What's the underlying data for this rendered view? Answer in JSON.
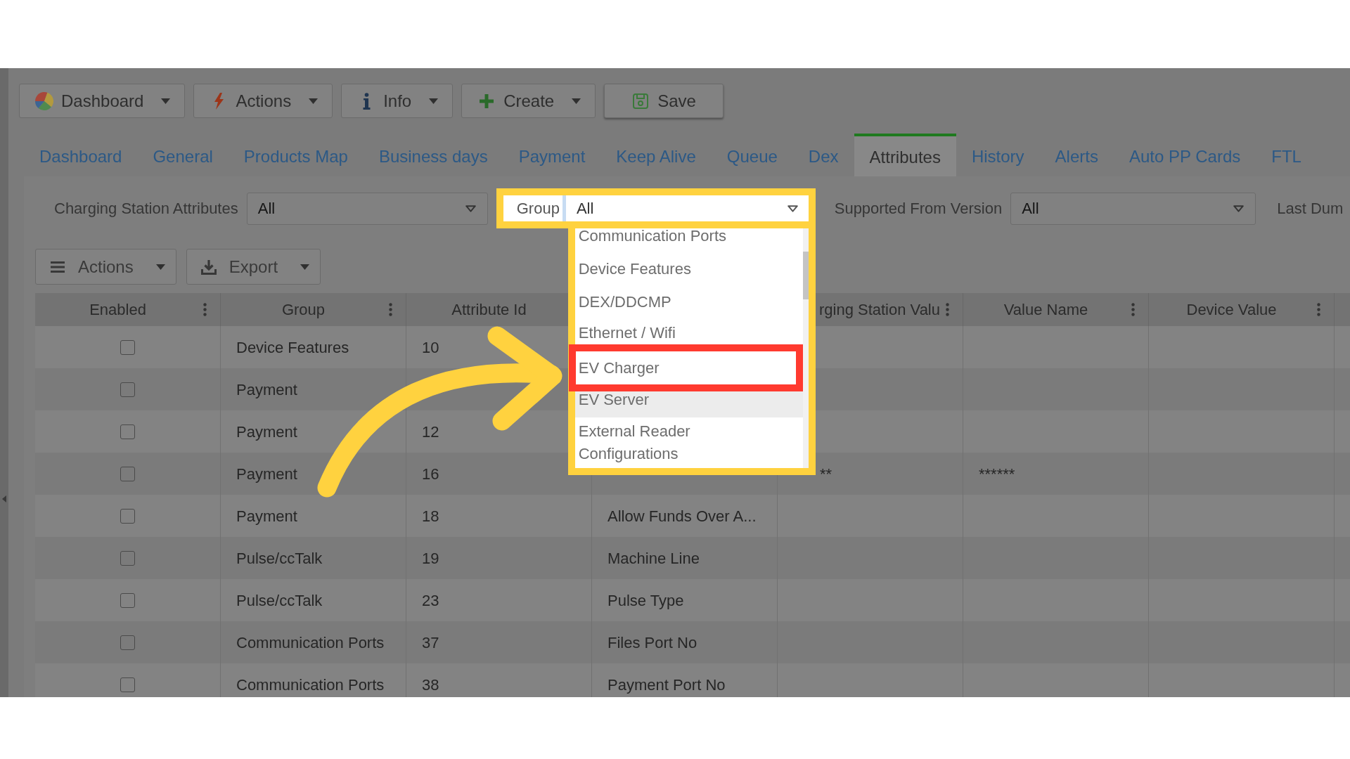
{
  "toolbar": [
    {
      "label": "Dashboard",
      "kind": "menu"
    },
    {
      "label": "Actions",
      "kind": "menu"
    },
    {
      "label": "Info",
      "kind": "menu"
    },
    {
      "label": "Create",
      "kind": "menu"
    },
    {
      "label": "Save",
      "kind": "button"
    }
  ],
  "tabs": [
    {
      "label": "Dashboard",
      "selected": false
    },
    {
      "label": "General",
      "selected": false
    },
    {
      "label": "Products Map",
      "selected": false
    },
    {
      "label": "Business days",
      "selected": false
    },
    {
      "label": "Payment",
      "selected": false
    },
    {
      "label": "Keep Alive",
      "selected": false
    },
    {
      "label": "Queue",
      "selected": false
    },
    {
      "label": "Dex",
      "selected": false
    },
    {
      "label": "Attributes",
      "selected": true
    },
    {
      "label": "History",
      "selected": false
    },
    {
      "label": "Alerts",
      "selected": false
    },
    {
      "label": "Auto PP Cards",
      "selected": false
    },
    {
      "label": "FTL",
      "selected": false
    }
  ],
  "filters": [
    {
      "label": "Charging Station Attributes",
      "value": "All",
      "spotlight": false,
      "expanded": false
    },
    {
      "label": "Group",
      "value": "All",
      "spotlight": true,
      "expanded": true,
      "options": [
        {
          "label": "Communication Ports",
          "highlighted": false,
          "marked": false
        },
        {
          "label": "Device Features",
          "highlighted": false,
          "marked": false
        },
        {
          "label": "DEX/DDCMP",
          "highlighted": false,
          "marked": false
        },
        {
          "label": "Ethernet / Wifi",
          "highlighted": false,
          "marked": false
        },
        {
          "label": "EV Charger",
          "highlighted": false,
          "marked": true
        },
        {
          "label": "EV Server",
          "highlighted": true,
          "marked": false
        },
        {
          "label": "External Reader Configurations",
          "highlighted": false,
          "marked": false
        }
      ]
    },
    {
      "label": "Supported From Version",
      "value": "All",
      "spotlight": false,
      "expanded": false
    },
    {
      "label": "Last Dum"
    }
  ],
  "grid_toolbar": [
    {
      "label": "Actions"
    },
    {
      "label": "Export"
    }
  ],
  "table": {
    "columns": [
      {
        "label": "Enabled"
      },
      {
        "label": "Group"
      },
      {
        "label": "Attribute Id"
      },
      {},
      {
        "label": "rging Station Valu"
      },
      {
        "label": "Value Name"
      },
      {
        "label": "Device Value"
      }
    ],
    "rows": [
      {
        "checked": false,
        "group": "Device Features",
        "attribute_id": "10"
      },
      {
        "checked": false,
        "group": "Payment"
      },
      {
        "checked": false,
        "group": "Payment",
        "attribute_id": "12"
      },
      {
        "checked": false,
        "group": "Payment",
        "attribute_id": "16",
        "column_5": "**",
        "value_name": "******"
      },
      {
        "checked": false,
        "group": "Payment",
        "attribute_id": "18",
        "column_4": "Allow Funds Over A..."
      },
      {
        "checked": false,
        "group": "Pulse/ccTalk",
        "attribute_id": "19",
        "column_4": "Machine Line"
      },
      {
        "checked": false,
        "group": "Pulse/ccTalk",
        "attribute_id": "23",
        "column_4": "Pulse Type"
      },
      {
        "checked": false,
        "group": "Communication Ports",
        "attribute_id": "37",
        "column_4": "Files Port No"
      },
      {
        "checked": false,
        "group": "Communication Ports",
        "attribute_id": "38",
        "column_4": "Payment Port No"
      }
    ]
  }
}
